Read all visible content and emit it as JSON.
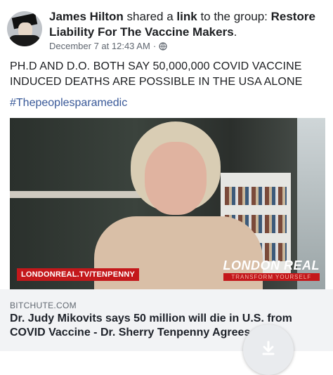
{
  "post": {
    "author": "James Hilton",
    "shared_text": " shared a ",
    "link_word": "link",
    "to_group_text": " to the group: ",
    "group_name": "Restore Liability For The Vaccine Makers",
    "period": ".",
    "timestamp": "December 7 at 12:43 AM",
    "separator": "·",
    "body_line1": "PH.D AND D.O. BOTH SAY 50,000,000 COVID VACCINE",
    "body_line2": "INDUCED DEATHS ARE POSSIBLE IN THE USA ALONE",
    "hashtag": "#Thepeoplesparamedic"
  },
  "video": {
    "overlay_label": "LONDONREAL.TV/TENPENNY",
    "brand_name": "LONDON REAL",
    "brand_tagline": "TRANSFORM YOURSELF"
  },
  "link_preview": {
    "domain": "BITCHUTE.COM",
    "headline": "Dr. Judy Mikovits says 50 million will die in U.S. from COVID Vaccine - Dr. Sherry Tenpenny Agrees"
  },
  "icons": {
    "globe": "globe-icon",
    "download": "download-icon"
  },
  "colors": {
    "hashtag": "#385898",
    "label_red": "#c4181b"
  }
}
